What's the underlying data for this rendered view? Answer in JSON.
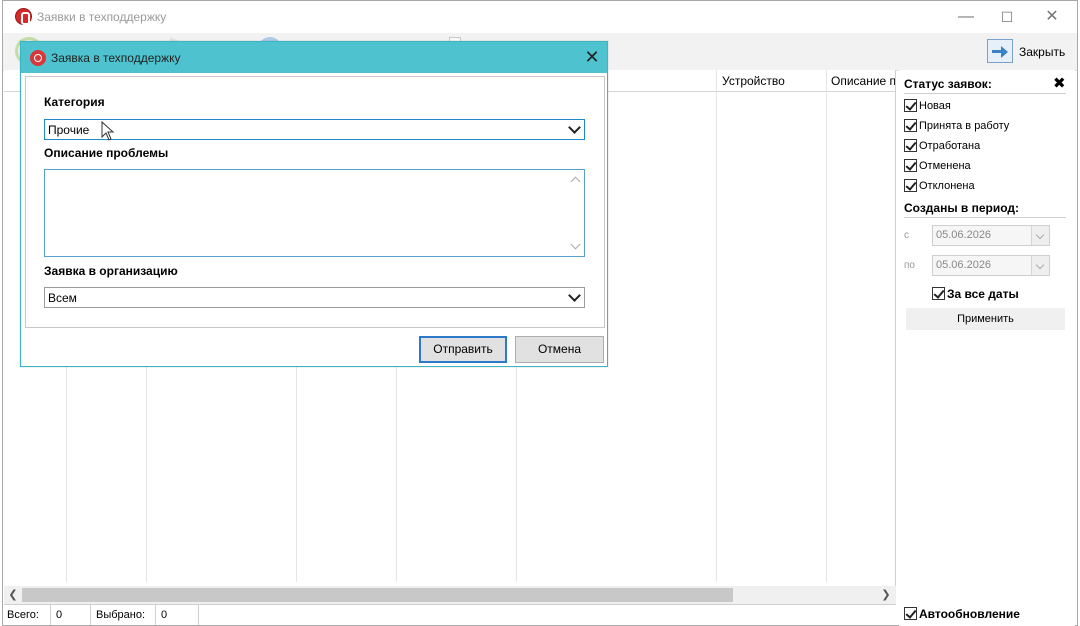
{
  "window": {
    "title": "Заявки в техподдержку",
    "controls": {
      "minimize": "—",
      "maximize": "☐",
      "close": "✕"
    }
  },
  "toolbar": {
    "close_label": "Закрыть"
  },
  "grid": {
    "columns": [
      "Устройство",
      "Описание пр"
    ]
  },
  "status": {
    "total_label": "Всего:",
    "total_value": "0",
    "selected_label": "Выбрано:",
    "selected_value": "0"
  },
  "side": {
    "status_title": "Статус заявок:",
    "close_glyph": "✖",
    "statuses": [
      "Новая",
      "Принята в работу",
      "Отработана",
      "Отменена",
      "Отклонена"
    ],
    "period_title": "Созданы в период:",
    "from_label": "с",
    "from_value": "05.06.2026",
    "to_label": "по",
    "to_value": "05.06.2026",
    "all_dates_label": "За все даты",
    "apply_label": "Применить",
    "auto_refresh_label": "Автообновление"
  },
  "dialog": {
    "title": "Заявка в техподдержку",
    "close_glyph": "✕",
    "category_label": "Категория",
    "category_value": "Прочие",
    "description_label": "Описание проблемы",
    "description_value": "",
    "org_label": "Заявка в организацию",
    "org_value": "Всем",
    "submit_label": "Отправить",
    "cancel_label": "Отмена"
  },
  "colors": {
    "dialog_title_bar": "#4ec3cf",
    "focus_border": "#2b79c8"
  }
}
